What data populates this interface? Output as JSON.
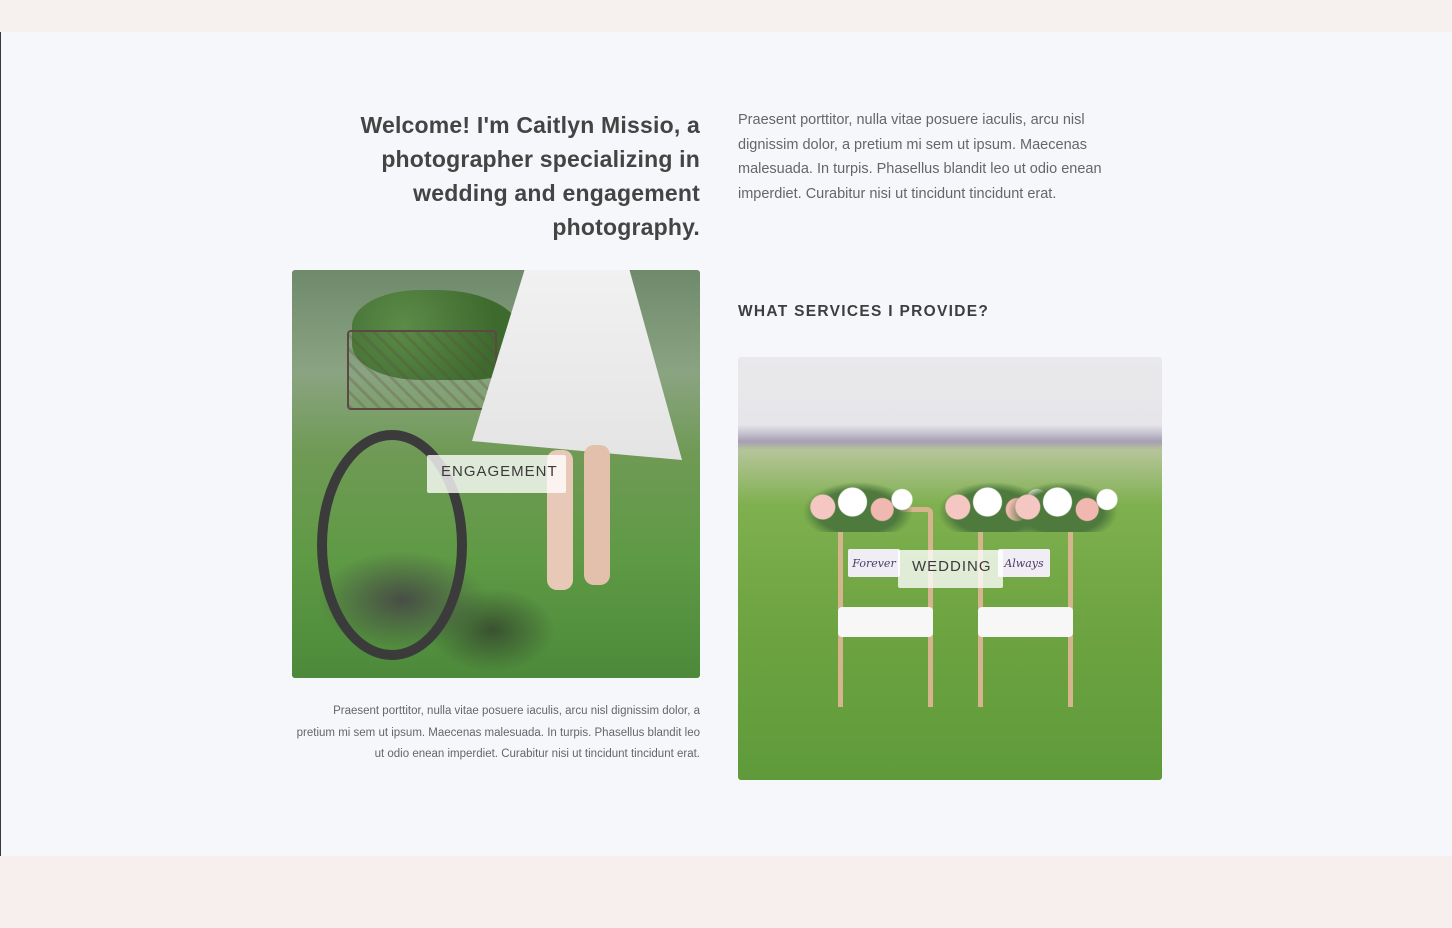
{
  "intro": {
    "heading": "Welcome! I'm Caitlyn Missio, a photographer specializing in wedding and engagement photography.",
    "text": "Praesent porttitor, nulla vitae posuere iaculis, arcu nisl dignissim dolor, a pretium mi sem ut ipsum. Maecenas malesuada. In turpis. Phasellus blandit leo ut odio enean imperdiet. Curabitur nisi ut tincidunt tincidunt erat."
  },
  "engagement": {
    "label": "ENGAGEMENT",
    "caption": "Praesent porttitor, nulla vitae posuere iaculis, arcu nisl dignissim dolor, a pretium mi sem ut ipsum. Maecenas malesuada. In turpis. Phasellus blandit leo ut odio enean imperdiet. Curabitur nisi ut tincidunt tincidunt erat."
  },
  "services": {
    "title": "WHAT SERVICES I PROVIDE?"
  },
  "wedding": {
    "label": "WEDDING",
    "sign_left": "Forever",
    "sign_right": "Always"
  },
  "colors": {
    "section_bg": "#f5f7fa",
    "band_bg": "#f6f0ef",
    "text": "#444444"
  }
}
